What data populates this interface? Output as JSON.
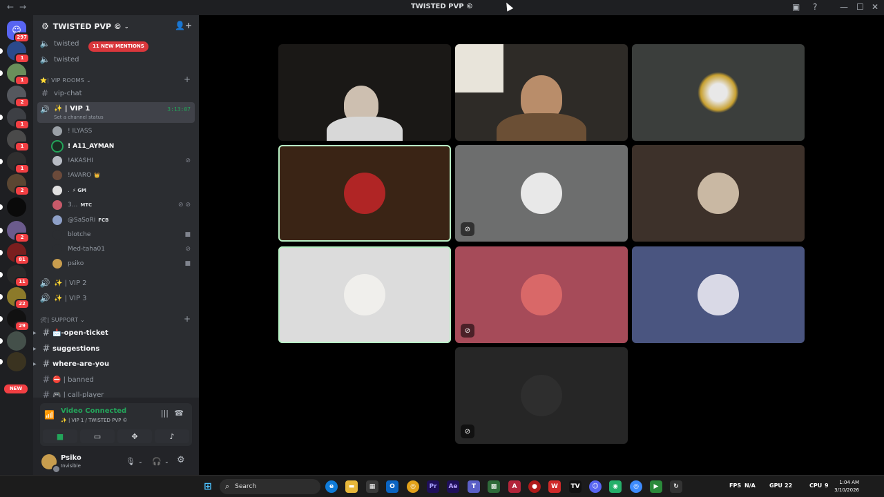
{
  "window": {
    "title": "TWISTED PVP ©",
    "back_glyph": "←",
    "forward_glyph": "→",
    "controls": {
      "minimize": "—",
      "maximize": "☐",
      "close": "✕"
    }
  },
  "server_rail": {
    "dm_badge": "297",
    "server_badges": [
      "1",
      "1",
      "2",
      "1",
      "1",
      "1",
      "2",
      "2",
      "81",
      "11",
      "22",
      "29"
    ],
    "new_label": "NEW"
  },
  "guild": {
    "name": "TWISTED PVP ©",
    "top_channels": [
      "twisted",
      "twisted"
    ],
    "mentions_pill": "11 NEW MENTIONS",
    "category_vip": "⭐| VIP ROOMS",
    "vip_chat": "vip-chat",
    "vip1": {
      "name": "✨ | VIP 1",
      "status": "Set a channel status",
      "timer": "3:13:07"
    },
    "members": [
      {
        "name": "! ILYASS",
        "tag": ""
      },
      {
        "name": "! A11_AYMAN",
        "tag": ""
      },
      {
        "name": "!AKASHI",
        "tag": ""
      },
      {
        "name": "!AVARO",
        "tag": "👑"
      },
      {
        "name": ".",
        "tag": "⚡ GM"
      },
      {
        "name": "3...",
        "tag": "MTC"
      },
      {
        "name": "@SaSoRi",
        "tag": "FCB"
      },
      {
        "name": "blotche",
        "tag": ""
      },
      {
        "name": "Med-taha01",
        "tag": ""
      },
      {
        "name": "psiko",
        "tag": ""
      }
    ],
    "vip2": "✨ | VIP 2",
    "vip3": "✨ | VIP 3",
    "category_support": "🛠| SUPPORT",
    "support_channels": [
      {
        "name": "📩-open-ticket"
      },
      {
        "name": "suggestions"
      },
      {
        "name": "where-are-you"
      },
      {
        "name": "⛔ | banned"
      },
      {
        "name": "🎮 | call-player"
      }
    ]
  },
  "voice_panel": {
    "status": "Video Connected",
    "location": "✨ | VIP 1 / TWISTED PVP ©"
  },
  "user": {
    "name": "Psiko",
    "status": "Invisible"
  },
  "taskbar": {
    "search_placeholder": "Search",
    "fps_label": "FPS",
    "fps_value": "N/A",
    "gpu_label": "GPU",
    "gpu_value": "22",
    "cpu_label": "CPU",
    "cpu_value": "9",
    "time": "1:04 AM",
    "date": "3/10/2026"
  },
  "colors": {
    "discord_dark": "#1e1f22",
    "sidebar": "#2b2d31",
    "online_green": "#23a55a",
    "mention_red": "#da373c",
    "blurple": "#5865f2"
  }
}
